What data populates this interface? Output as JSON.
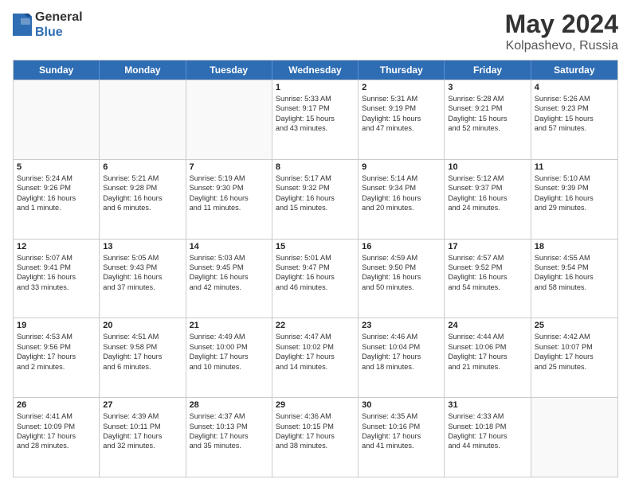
{
  "header": {
    "logo": {
      "general": "General",
      "blue": "Blue"
    },
    "title": "May 2024",
    "location": "Kolpashevo, Russia"
  },
  "calendar": {
    "days_of_week": [
      "Sunday",
      "Monday",
      "Tuesday",
      "Wednesday",
      "Thursday",
      "Friday",
      "Saturday"
    ],
    "weeks": [
      [
        {
          "day": "",
          "sunrise": "",
          "sunset": "",
          "daylight": "",
          "empty": true
        },
        {
          "day": "",
          "sunrise": "",
          "sunset": "",
          "daylight": "",
          "empty": true
        },
        {
          "day": "",
          "sunrise": "",
          "sunset": "",
          "daylight": "",
          "empty": true
        },
        {
          "day": "1",
          "sunrise": "Sunrise: 5:33 AM",
          "sunset": "Sunset: 9:17 PM",
          "daylight": "Daylight: 15 hours",
          "daylight2": "and 43 minutes.",
          "empty": false
        },
        {
          "day": "2",
          "sunrise": "Sunrise: 5:31 AM",
          "sunset": "Sunset: 9:19 PM",
          "daylight": "Daylight: 15 hours",
          "daylight2": "and 47 minutes.",
          "empty": false
        },
        {
          "day": "3",
          "sunrise": "Sunrise: 5:28 AM",
          "sunset": "Sunset: 9:21 PM",
          "daylight": "Daylight: 15 hours",
          "daylight2": "and 52 minutes.",
          "empty": false
        },
        {
          "day": "4",
          "sunrise": "Sunrise: 5:26 AM",
          "sunset": "Sunset: 9:23 PM",
          "daylight": "Daylight: 15 hours",
          "daylight2": "and 57 minutes.",
          "empty": false
        }
      ],
      [
        {
          "day": "5",
          "sunrise": "Sunrise: 5:24 AM",
          "sunset": "Sunset: 9:26 PM",
          "daylight": "Daylight: 16 hours",
          "daylight2": "and 1 minute.",
          "empty": false
        },
        {
          "day": "6",
          "sunrise": "Sunrise: 5:21 AM",
          "sunset": "Sunset: 9:28 PM",
          "daylight": "Daylight: 16 hours",
          "daylight2": "and 6 minutes.",
          "empty": false
        },
        {
          "day": "7",
          "sunrise": "Sunrise: 5:19 AM",
          "sunset": "Sunset: 9:30 PM",
          "daylight": "Daylight: 16 hours",
          "daylight2": "and 11 minutes.",
          "empty": false
        },
        {
          "day": "8",
          "sunrise": "Sunrise: 5:17 AM",
          "sunset": "Sunset: 9:32 PM",
          "daylight": "Daylight: 16 hours",
          "daylight2": "and 15 minutes.",
          "empty": false
        },
        {
          "day": "9",
          "sunrise": "Sunrise: 5:14 AM",
          "sunset": "Sunset: 9:34 PM",
          "daylight": "Daylight: 16 hours",
          "daylight2": "and 20 minutes.",
          "empty": false
        },
        {
          "day": "10",
          "sunrise": "Sunrise: 5:12 AM",
          "sunset": "Sunset: 9:37 PM",
          "daylight": "Daylight: 16 hours",
          "daylight2": "and 24 minutes.",
          "empty": false
        },
        {
          "day": "11",
          "sunrise": "Sunrise: 5:10 AM",
          "sunset": "Sunset: 9:39 PM",
          "daylight": "Daylight: 16 hours",
          "daylight2": "and 29 minutes.",
          "empty": false
        }
      ],
      [
        {
          "day": "12",
          "sunrise": "Sunrise: 5:07 AM",
          "sunset": "Sunset: 9:41 PM",
          "daylight": "Daylight: 16 hours",
          "daylight2": "and 33 minutes.",
          "empty": false
        },
        {
          "day": "13",
          "sunrise": "Sunrise: 5:05 AM",
          "sunset": "Sunset: 9:43 PM",
          "daylight": "Daylight: 16 hours",
          "daylight2": "and 37 minutes.",
          "empty": false
        },
        {
          "day": "14",
          "sunrise": "Sunrise: 5:03 AM",
          "sunset": "Sunset: 9:45 PM",
          "daylight": "Daylight: 16 hours",
          "daylight2": "and 42 minutes.",
          "empty": false
        },
        {
          "day": "15",
          "sunrise": "Sunrise: 5:01 AM",
          "sunset": "Sunset: 9:47 PM",
          "daylight": "Daylight: 16 hours",
          "daylight2": "and 46 minutes.",
          "empty": false
        },
        {
          "day": "16",
          "sunrise": "Sunrise: 4:59 AM",
          "sunset": "Sunset: 9:50 PM",
          "daylight": "Daylight: 16 hours",
          "daylight2": "and 50 minutes.",
          "empty": false
        },
        {
          "day": "17",
          "sunrise": "Sunrise: 4:57 AM",
          "sunset": "Sunset: 9:52 PM",
          "daylight": "Daylight: 16 hours",
          "daylight2": "and 54 minutes.",
          "empty": false
        },
        {
          "day": "18",
          "sunrise": "Sunrise: 4:55 AM",
          "sunset": "Sunset: 9:54 PM",
          "daylight": "Daylight: 16 hours",
          "daylight2": "and 58 minutes.",
          "empty": false
        }
      ],
      [
        {
          "day": "19",
          "sunrise": "Sunrise: 4:53 AM",
          "sunset": "Sunset: 9:56 PM",
          "daylight": "Daylight: 17 hours",
          "daylight2": "and 2 minutes.",
          "empty": false
        },
        {
          "day": "20",
          "sunrise": "Sunrise: 4:51 AM",
          "sunset": "Sunset: 9:58 PM",
          "daylight": "Daylight: 17 hours",
          "daylight2": "and 6 minutes.",
          "empty": false
        },
        {
          "day": "21",
          "sunrise": "Sunrise: 4:49 AM",
          "sunset": "Sunset: 10:00 PM",
          "daylight": "Daylight: 17 hours",
          "daylight2": "and 10 minutes.",
          "empty": false
        },
        {
          "day": "22",
          "sunrise": "Sunrise: 4:47 AM",
          "sunset": "Sunset: 10:02 PM",
          "daylight": "Daylight: 17 hours",
          "daylight2": "and 14 minutes.",
          "empty": false
        },
        {
          "day": "23",
          "sunrise": "Sunrise: 4:46 AM",
          "sunset": "Sunset: 10:04 PM",
          "daylight": "Daylight: 17 hours",
          "daylight2": "and 18 minutes.",
          "empty": false
        },
        {
          "day": "24",
          "sunrise": "Sunrise: 4:44 AM",
          "sunset": "Sunset: 10:06 PM",
          "daylight": "Daylight: 17 hours",
          "daylight2": "and 21 minutes.",
          "empty": false
        },
        {
          "day": "25",
          "sunrise": "Sunrise: 4:42 AM",
          "sunset": "Sunset: 10:07 PM",
          "daylight": "Daylight: 17 hours",
          "daylight2": "and 25 minutes.",
          "empty": false
        }
      ],
      [
        {
          "day": "26",
          "sunrise": "Sunrise: 4:41 AM",
          "sunset": "Sunset: 10:09 PM",
          "daylight": "Daylight: 17 hours",
          "daylight2": "and 28 minutes.",
          "empty": false
        },
        {
          "day": "27",
          "sunrise": "Sunrise: 4:39 AM",
          "sunset": "Sunset: 10:11 PM",
          "daylight": "Daylight: 17 hours",
          "daylight2": "and 32 minutes.",
          "empty": false
        },
        {
          "day": "28",
          "sunrise": "Sunrise: 4:37 AM",
          "sunset": "Sunset: 10:13 PM",
          "daylight": "Daylight: 17 hours",
          "daylight2": "and 35 minutes.",
          "empty": false
        },
        {
          "day": "29",
          "sunrise": "Sunrise: 4:36 AM",
          "sunset": "Sunset: 10:15 PM",
          "daylight": "Daylight: 17 hours",
          "daylight2": "and 38 minutes.",
          "empty": false
        },
        {
          "day": "30",
          "sunrise": "Sunrise: 4:35 AM",
          "sunset": "Sunset: 10:16 PM",
          "daylight": "Daylight: 17 hours",
          "daylight2": "and 41 minutes.",
          "empty": false
        },
        {
          "day": "31",
          "sunrise": "Sunrise: 4:33 AM",
          "sunset": "Sunset: 10:18 PM",
          "daylight": "Daylight: 17 hours",
          "daylight2": "and 44 minutes.",
          "empty": false
        },
        {
          "day": "",
          "sunrise": "",
          "sunset": "",
          "daylight": "",
          "daylight2": "",
          "empty": true
        }
      ]
    ]
  }
}
